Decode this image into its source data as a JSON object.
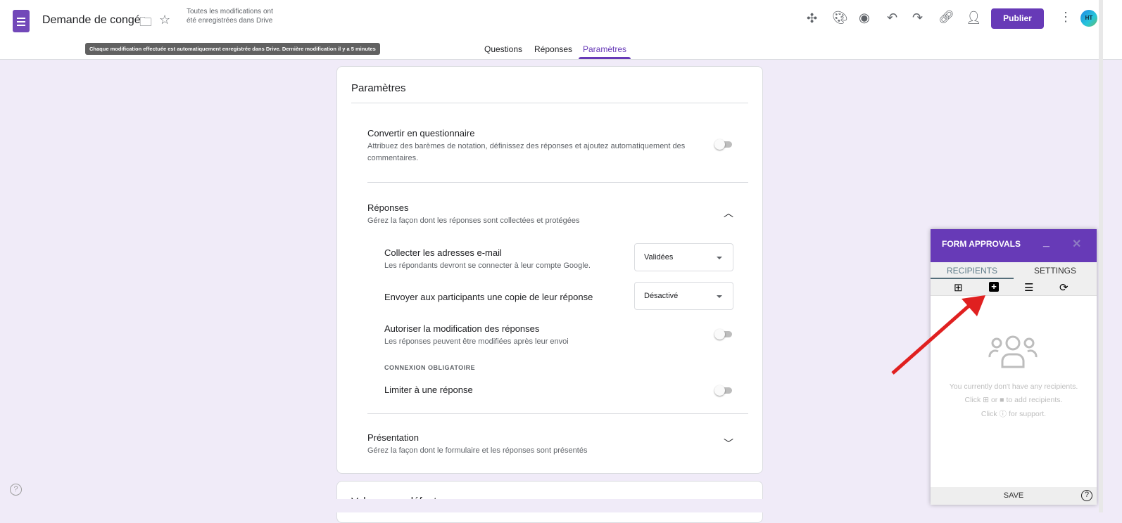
{
  "header": {
    "title": "Demande de congé",
    "saved_status": "Toutes les modifications ont été enregistrées dans Drive",
    "tooltip": "Chaque modification effectuée est automatiquement enregistrée dans Drive. Dernière modification il y a 5 minutes",
    "publish_label": "Publier",
    "avatar_initials": "HT",
    "tabs": [
      {
        "label": "Questions"
      },
      {
        "label": "Réponses"
      },
      {
        "label": "Paramètres",
        "active": true
      }
    ]
  },
  "accent": "#673ab7",
  "settings": {
    "title": "Paramètres",
    "quiz": {
      "title": "Convertir en questionnaire",
      "desc": "Attribuez des barèmes de notation, définissez des réponses et ajoutez automatiquement des commentaires.",
      "enabled": false
    },
    "responses": {
      "title": "Réponses",
      "desc": "Gérez la façon dont les réponses sont collectées et protégées",
      "expanded": true,
      "collect_email": {
        "title": "Collecter les adresses e-mail",
        "desc": "Les répondants devront se connecter à leur compte Google.",
        "value": "Validées"
      },
      "send_copy": {
        "title": "Envoyer aux participants une copie de leur réponse",
        "value": "Désactivé"
      },
      "allow_edit": {
        "title": "Autoriser la modification des réponses",
        "desc": "Les réponses peuvent être modifiées après leur envoi",
        "enabled": false
      },
      "section_label": "CONNEXION OBLIGATOIRE",
      "limit_one": {
        "title": "Limiter à une réponse",
        "enabled": false
      }
    },
    "presentation": {
      "title": "Présentation",
      "desc": "Gérez la façon dont le formulaire et les réponses sont présentés",
      "expanded": false
    },
    "next_card_title": "Valeurs par défaut"
  },
  "panel": {
    "title": "FORM APPROVALS",
    "tabs": [
      "RECIPIENTS",
      "SETTINGS"
    ],
    "empty_line1": "You currently don't have any recipients.",
    "empty_line2a": "Click",
    "empty_line2b": "or",
    "empty_line2c": "to add recipients.",
    "empty_line3a": "Click",
    "empty_line3b": "for support.",
    "save_label": "SAVE"
  }
}
